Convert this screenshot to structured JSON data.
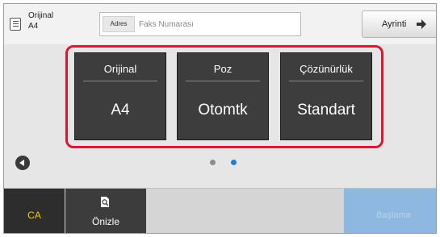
{
  "original_info": {
    "line1": "Orijinal",
    "line2": "A4"
  },
  "address": {
    "button_label": "Adres",
    "placeholder": "Faks Numarası"
  },
  "detail_button": {
    "label": "Ayrinti"
  },
  "settings": [
    {
      "title": "Orijinal",
      "value": "A4"
    },
    {
      "title": "Poz",
      "value": "Otomtk"
    },
    {
      "title": "Çözünürlük",
      "value": "Standart"
    }
  ],
  "pagination": {
    "current": 2,
    "total": 2
  },
  "bottom": {
    "ca_label": "CA",
    "preview_label": "Önizle",
    "start_label": "Başlama"
  },
  "colors": {
    "highlight": "#d61a32",
    "active_dot": "#1e7fd8",
    "inactive_dot": "#8c8c8c",
    "ca_text": "#f0d000",
    "start_bg": "#8fb8e0"
  }
}
